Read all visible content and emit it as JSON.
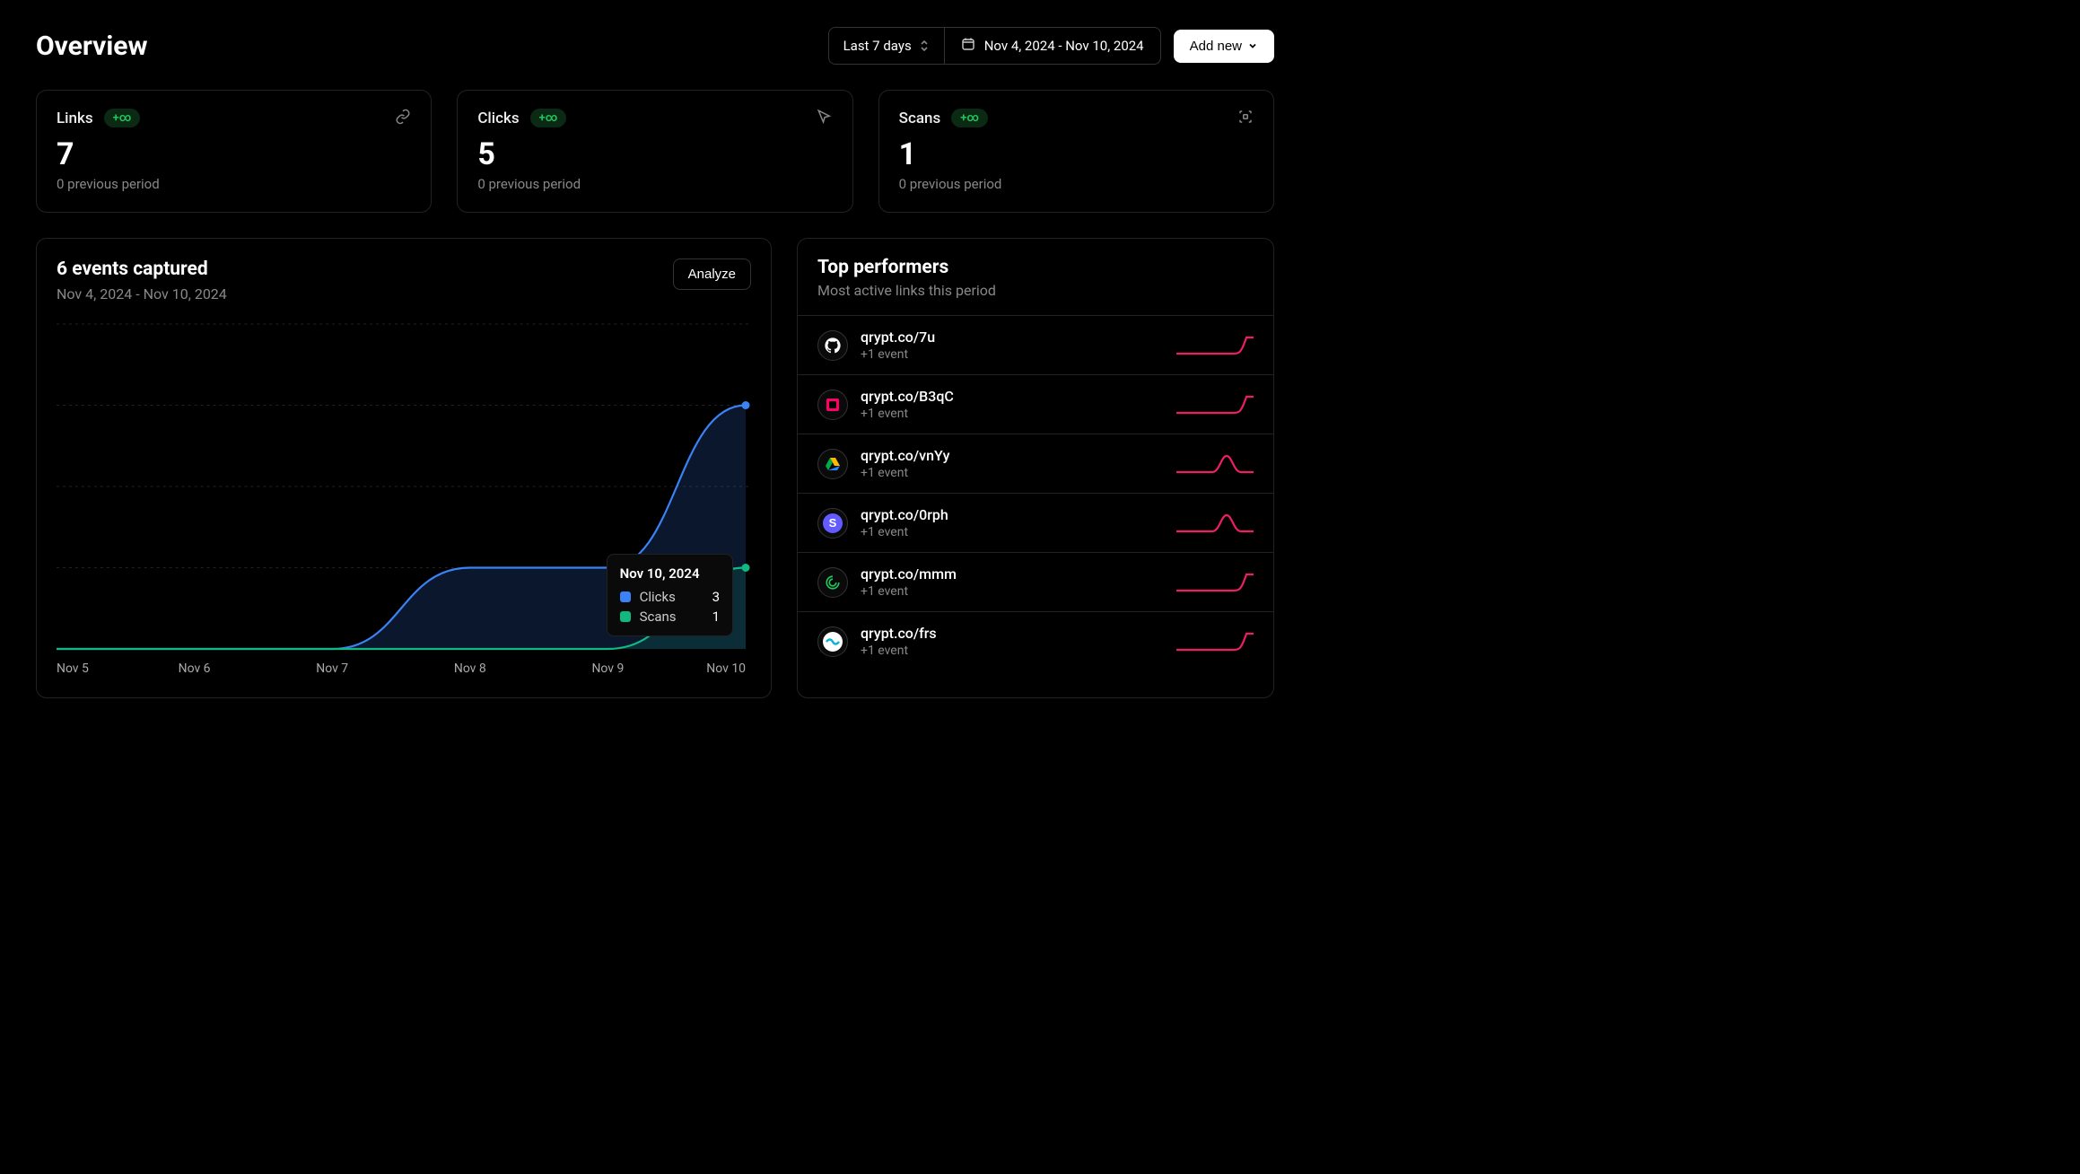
{
  "header": {
    "title": "Overview",
    "period_label": "Last 7 days",
    "date_range": "Nov 4, 2024 - Nov 10, 2024",
    "add_new_label": "Add new"
  },
  "stats": [
    {
      "label": "Links",
      "badge": "+∞",
      "value": "7",
      "sub": "0 previous period",
      "icon": "link"
    },
    {
      "label": "Clicks",
      "badge": "+∞",
      "value": "5",
      "sub": "0 previous period",
      "icon": "cursor"
    },
    {
      "label": "Scans",
      "badge": "+∞",
      "value": "1",
      "sub": "0 previous period",
      "icon": "scan"
    }
  ],
  "chart": {
    "title": "6 events captured",
    "sub": "Nov 4, 2024 - Nov 10, 2024",
    "analyze_label": "Analyze",
    "tooltip": {
      "title": "Nov 10, 2024",
      "rows": [
        {
          "label": "Clicks",
          "value": "3",
          "color": "#3b82f6"
        },
        {
          "label": "Scans",
          "value": "1",
          "color": "#10b981"
        }
      ]
    }
  },
  "chart_data": {
    "type": "line",
    "categories": [
      "Nov 5",
      "Nov 6",
      "Nov 7",
      "Nov 8",
      "Nov 9",
      "Nov 10"
    ],
    "series": [
      {
        "name": "Clicks",
        "color": "#3b82f6",
        "values": [
          0,
          0,
          0,
          1,
          1,
          3
        ]
      },
      {
        "name": "Scans",
        "color": "#10b981",
        "values": [
          0,
          0,
          0,
          0,
          0,
          1
        ]
      }
    ],
    "xlabel": "",
    "ylabel": "",
    "ylim": [
      0,
      4
    ]
  },
  "performers": {
    "title": "Top performers",
    "sub": "Most active links this period",
    "items": [
      {
        "link": "qrypt.co/7u",
        "sub": "+1 event",
        "avatar": "github",
        "spark": "flat-up"
      },
      {
        "link": "qrypt.co/B3qC",
        "sub": "+1 event",
        "avatar": "square",
        "spark": "flat-up"
      },
      {
        "link": "qrypt.co/vnYy",
        "sub": "+1 event",
        "avatar": "gdrive",
        "spark": "bump"
      },
      {
        "link": "qrypt.co/0rph",
        "sub": "+1 event",
        "avatar": "s-badge",
        "spark": "bump"
      },
      {
        "link": "qrypt.co/mmm",
        "sub": "+1 event",
        "avatar": "swirl",
        "spark": "flat-up"
      },
      {
        "link": "qrypt.co/frs",
        "sub": "+1 event",
        "avatar": "wave",
        "spark": "flat-up"
      }
    ]
  }
}
